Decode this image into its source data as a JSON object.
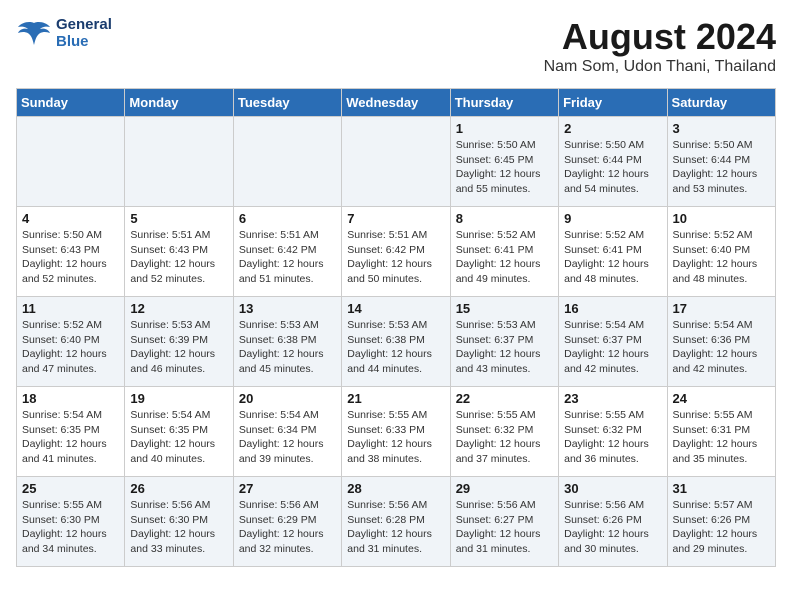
{
  "header": {
    "logo_line1": "General",
    "logo_line2": "Blue",
    "main_title": "August 2024",
    "subtitle": "Nam Som, Udon Thani, Thailand"
  },
  "weekdays": [
    "Sunday",
    "Monday",
    "Tuesday",
    "Wednesday",
    "Thursday",
    "Friday",
    "Saturday"
  ],
  "weeks": [
    [
      {
        "day": "",
        "detail": ""
      },
      {
        "day": "",
        "detail": ""
      },
      {
        "day": "",
        "detail": ""
      },
      {
        "day": "",
        "detail": ""
      },
      {
        "day": "1",
        "detail": "Sunrise: 5:50 AM\nSunset: 6:45 PM\nDaylight: 12 hours\nand 55 minutes."
      },
      {
        "day": "2",
        "detail": "Sunrise: 5:50 AM\nSunset: 6:44 PM\nDaylight: 12 hours\nand 54 minutes."
      },
      {
        "day": "3",
        "detail": "Sunrise: 5:50 AM\nSunset: 6:44 PM\nDaylight: 12 hours\nand 53 minutes."
      }
    ],
    [
      {
        "day": "4",
        "detail": "Sunrise: 5:50 AM\nSunset: 6:43 PM\nDaylight: 12 hours\nand 52 minutes."
      },
      {
        "day": "5",
        "detail": "Sunrise: 5:51 AM\nSunset: 6:43 PM\nDaylight: 12 hours\nand 52 minutes."
      },
      {
        "day": "6",
        "detail": "Sunrise: 5:51 AM\nSunset: 6:42 PM\nDaylight: 12 hours\nand 51 minutes."
      },
      {
        "day": "7",
        "detail": "Sunrise: 5:51 AM\nSunset: 6:42 PM\nDaylight: 12 hours\nand 50 minutes."
      },
      {
        "day": "8",
        "detail": "Sunrise: 5:52 AM\nSunset: 6:41 PM\nDaylight: 12 hours\nand 49 minutes."
      },
      {
        "day": "9",
        "detail": "Sunrise: 5:52 AM\nSunset: 6:41 PM\nDaylight: 12 hours\nand 48 minutes."
      },
      {
        "day": "10",
        "detail": "Sunrise: 5:52 AM\nSunset: 6:40 PM\nDaylight: 12 hours\nand 48 minutes."
      }
    ],
    [
      {
        "day": "11",
        "detail": "Sunrise: 5:52 AM\nSunset: 6:40 PM\nDaylight: 12 hours\nand 47 minutes."
      },
      {
        "day": "12",
        "detail": "Sunrise: 5:53 AM\nSunset: 6:39 PM\nDaylight: 12 hours\nand 46 minutes."
      },
      {
        "day": "13",
        "detail": "Sunrise: 5:53 AM\nSunset: 6:38 PM\nDaylight: 12 hours\nand 45 minutes."
      },
      {
        "day": "14",
        "detail": "Sunrise: 5:53 AM\nSunset: 6:38 PM\nDaylight: 12 hours\nand 44 minutes."
      },
      {
        "day": "15",
        "detail": "Sunrise: 5:53 AM\nSunset: 6:37 PM\nDaylight: 12 hours\nand 43 minutes."
      },
      {
        "day": "16",
        "detail": "Sunrise: 5:54 AM\nSunset: 6:37 PM\nDaylight: 12 hours\nand 42 minutes."
      },
      {
        "day": "17",
        "detail": "Sunrise: 5:54 AM\nSunset: 6:36 PM\nDaylight: 12 hours\nand 42 minutes."
      }
    ],
    [
      {
        "day": "18",
        "detail": "Sunrise: 5:54 AM\nSunset: 6:35 PM\nDaylight: 12 hours\nand 41 minutes."
      },
      {
        "day": "19",
        "detail": "Sunrise: 5:54 AM\nSunset: 6:35 PM\nDaylight: 12 hours\nand 40 minutes."
      },
      {
        "day": "20",
        "detail": "Sunrise: 5:54 AM\nSunset: 6:34 PM\nDaylight: 12 hours\nand 39 minutes."
      },
      {
        "day": "21",
        "detail": "Sunrise: 5:55 AM\nSunset: 6:33 PM\nDaylight: 12 hours\nand 38 minutes."
      },
      {
        "day": "22",
        "detail": "Sunrise: 5:55 AM\nSunset: 6:32 PM\nDaylight: 12 hours\nand 37 minutes."
      },
      {
        "day": "23",
        "detail": "Sunrise: 5:55 AM\nSunset: 6:32 PM\nDaylight: 12 hours\nand 36 minutes."
      },
      {
        "day": "24",
        "detail": "Sunrise: 5:55 AM\nSunset: 6:31 PM\nDaylight: 12 hours\nand 35 minutes."
      }
    ],
    [
      {
        "day": "25",
        "detail": "Sunrise: 5:55 AM\nSunset: 6:30 PM\nDaylight: 12 hours\nand 34 minutes."
      },
      {
        "day": "26",
        "detail": "Sunrise: 5:56 AM\nSunset: 6:30 PM\nDaylight: 12 hours\nand 33 minutes."
      },
      {
        "day": "27",
        "detail": "Sunrise: 5:56 AM\nSunset: 6:29 PM\nDaylight: 12 hours\nand 32 minutes."
      },
      {
        "day": "28",
        "detail": "Sunrise: 5:56 AM\nSunset: 6:28 PM\nDaylight: 12 hours\nand 31 minutes."
      },
      {
        "day": "29",
        "detail": "Sunrise: 5:56 AM\nSunset: 6:27 PM\nDaylight: 12 hours\nand 31 minutes."
      },
      {
        "day": "30",
        "detail": "Sunrise: 5:56 AM\nSunset: 6:26 PM\nDaylight: 12 hours\nand 30 minutes."
      },
      {
        "day": "31",
        "detail": "Sunrise: 5:57 AM\nSunset: 6:26 PM\nDaylight: 12 hours\nand 29 minutes."
      }
    ]
  ]
}
